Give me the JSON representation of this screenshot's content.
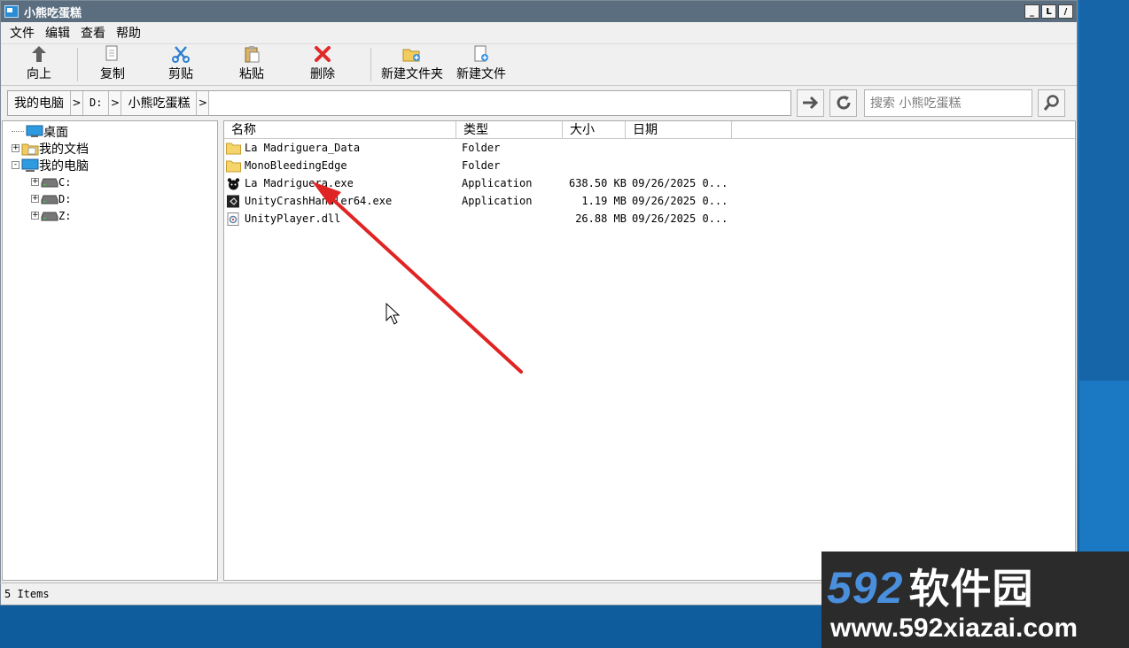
{
  "window": {
    "title": "小熊吃蛋糕",
    "title_buttons": [
      "_",
      "L",
      "/"
    ]
  },
  "menu": [
    "文件",
    "编辑",
    "查看",
    "帮助"
  ],
  "toolbar": {
    "up": "向上",
    "copy": "复制",
    "cut": "剪贴",
    "paste": "粘贴",
    "delete": "删除",
    "new_folder": "新建文件夹",
    "new_file": "新建文件"
  },
  "address": {
    "crumbs": [
      "我的电脑",
      "D:",
      "小熊吃蛋糕"
    ],
    "search_placeholder": "搜索 小熊吃蛋糕"
  },
  "tree": {
    "items": [
      {
        "label": "桌面",
        "level": 0,
        "expander": ""
      },
      {
        "label": "我的文档",
        "level": 0,
        "expander": "+"
      },
      {
        "label": "我的电脑",
        "level": 0,
        "expander": "-"
      },
      {
        "label": "C:",
        "level": 1,
        "expander": "+"
      },
      {
        "label": "D:",
        "level": 1,
        "expander": "+"
      },
      {
        "label": "Z:",
        "level": 1,
        "expander": "+"
      }
    ]
  },
  "columns": [
    "名称",
    "类型",
    "大小",
    "日期"
  ],
  "files": [
    {
      "name": "La Madriguera_Data",
      "type": "Folder",
      "size": "",
      "date": "",
      "icon": "folder-icon"
    },
    {
      "name": "MonoBleedingEdge",
      "type": "Folder",
      "size": "",
      "date": "",
      "icon": "folder-icon"
    },
    {
      "name": "La Madriguera.exe",
      "type": "Application",
      "size": "638.50 KB",
      "date": "09/26/2025 0...",
      "icon": "game-exe-icon"
    },
    {
      "name": "UnityCrashHandler64.exe",
      "type": "Application",
      "size": "1.19 MB",
      "date": "09/26/2025 0...",
      "icon": "unity-exe-icon"
    },
    {
      "name": "UnityPlayer.dll",
      "type": "",
      "size": "26.88 MB",
      "date": "09/26/2025 0...",
      "icon": "dll-icon"
    }
  ],
  "status": "5 Items",
  "watermark": {
    "logo_num": "592",
    "logo_cn": "软件园",
    "url": "www.592xiazai.com"
  },
  "colors": {
    "titlebar": "#5a6e80",
    "arrow": "#e02424",
    "desktop": "#1a6aad",
    "folder": "#f5d56b"
  }
}
